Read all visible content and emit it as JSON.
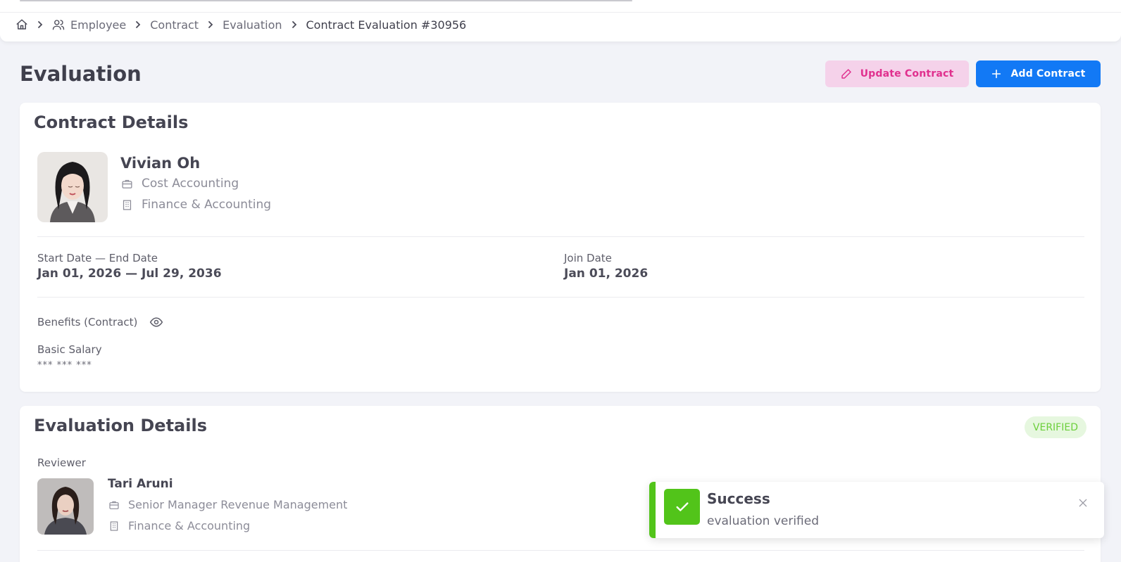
{
  "breadcrumb": {
    "items": [
      {
        "label": "Employee"
      },
      {
        "label": "Contract"
      },
      {
        "label": "Evaluation"
      }
    ],
    "current": "Contract Evaluation #30956"
  },
  "page": {
    "title": "Evaluation",
    "update_button": "Update Contract",
    "add_button": "Add Contract"
  },
  "contract": {
    "title": "Contract Details",
    "employee": {
      "name": "Vivian Oh",
      "position": "Cost Accounting",
      "department": "Finance & Accounting"
    },
    "period_label": "Start Date — End Date",
    "period_value": "Jan 01, 2026 — Jul 29, 2036",
    "join_label": "Join Date",
    "join_value": "Jan 01, 2026",
    "benefits_label": "Benefits (Contract)",
    "salary_label": "Basic Salary",
    "salary_value": "*** *** ***"
  },
  "evaluation": {
    "title": "Evaluation Details",
    "status": "VERIFIED",
    "reviewer_label": "Reviewer",
    "reviewer": {
      "name": "Tari Aruni",
      "position": "Senior Manager Revenue Management",
      "department": "Finance & Accounting"
    }
  },
  "toast": {
    "title": "Success",
    "message": "evaluation verified"
  },
  "colors": {
    "primary": "#1279f5",
    "update_bg": "#f5d2ea",
    "update_fg": "#e0308e",
    "success": "#52c41a"
  }
}
